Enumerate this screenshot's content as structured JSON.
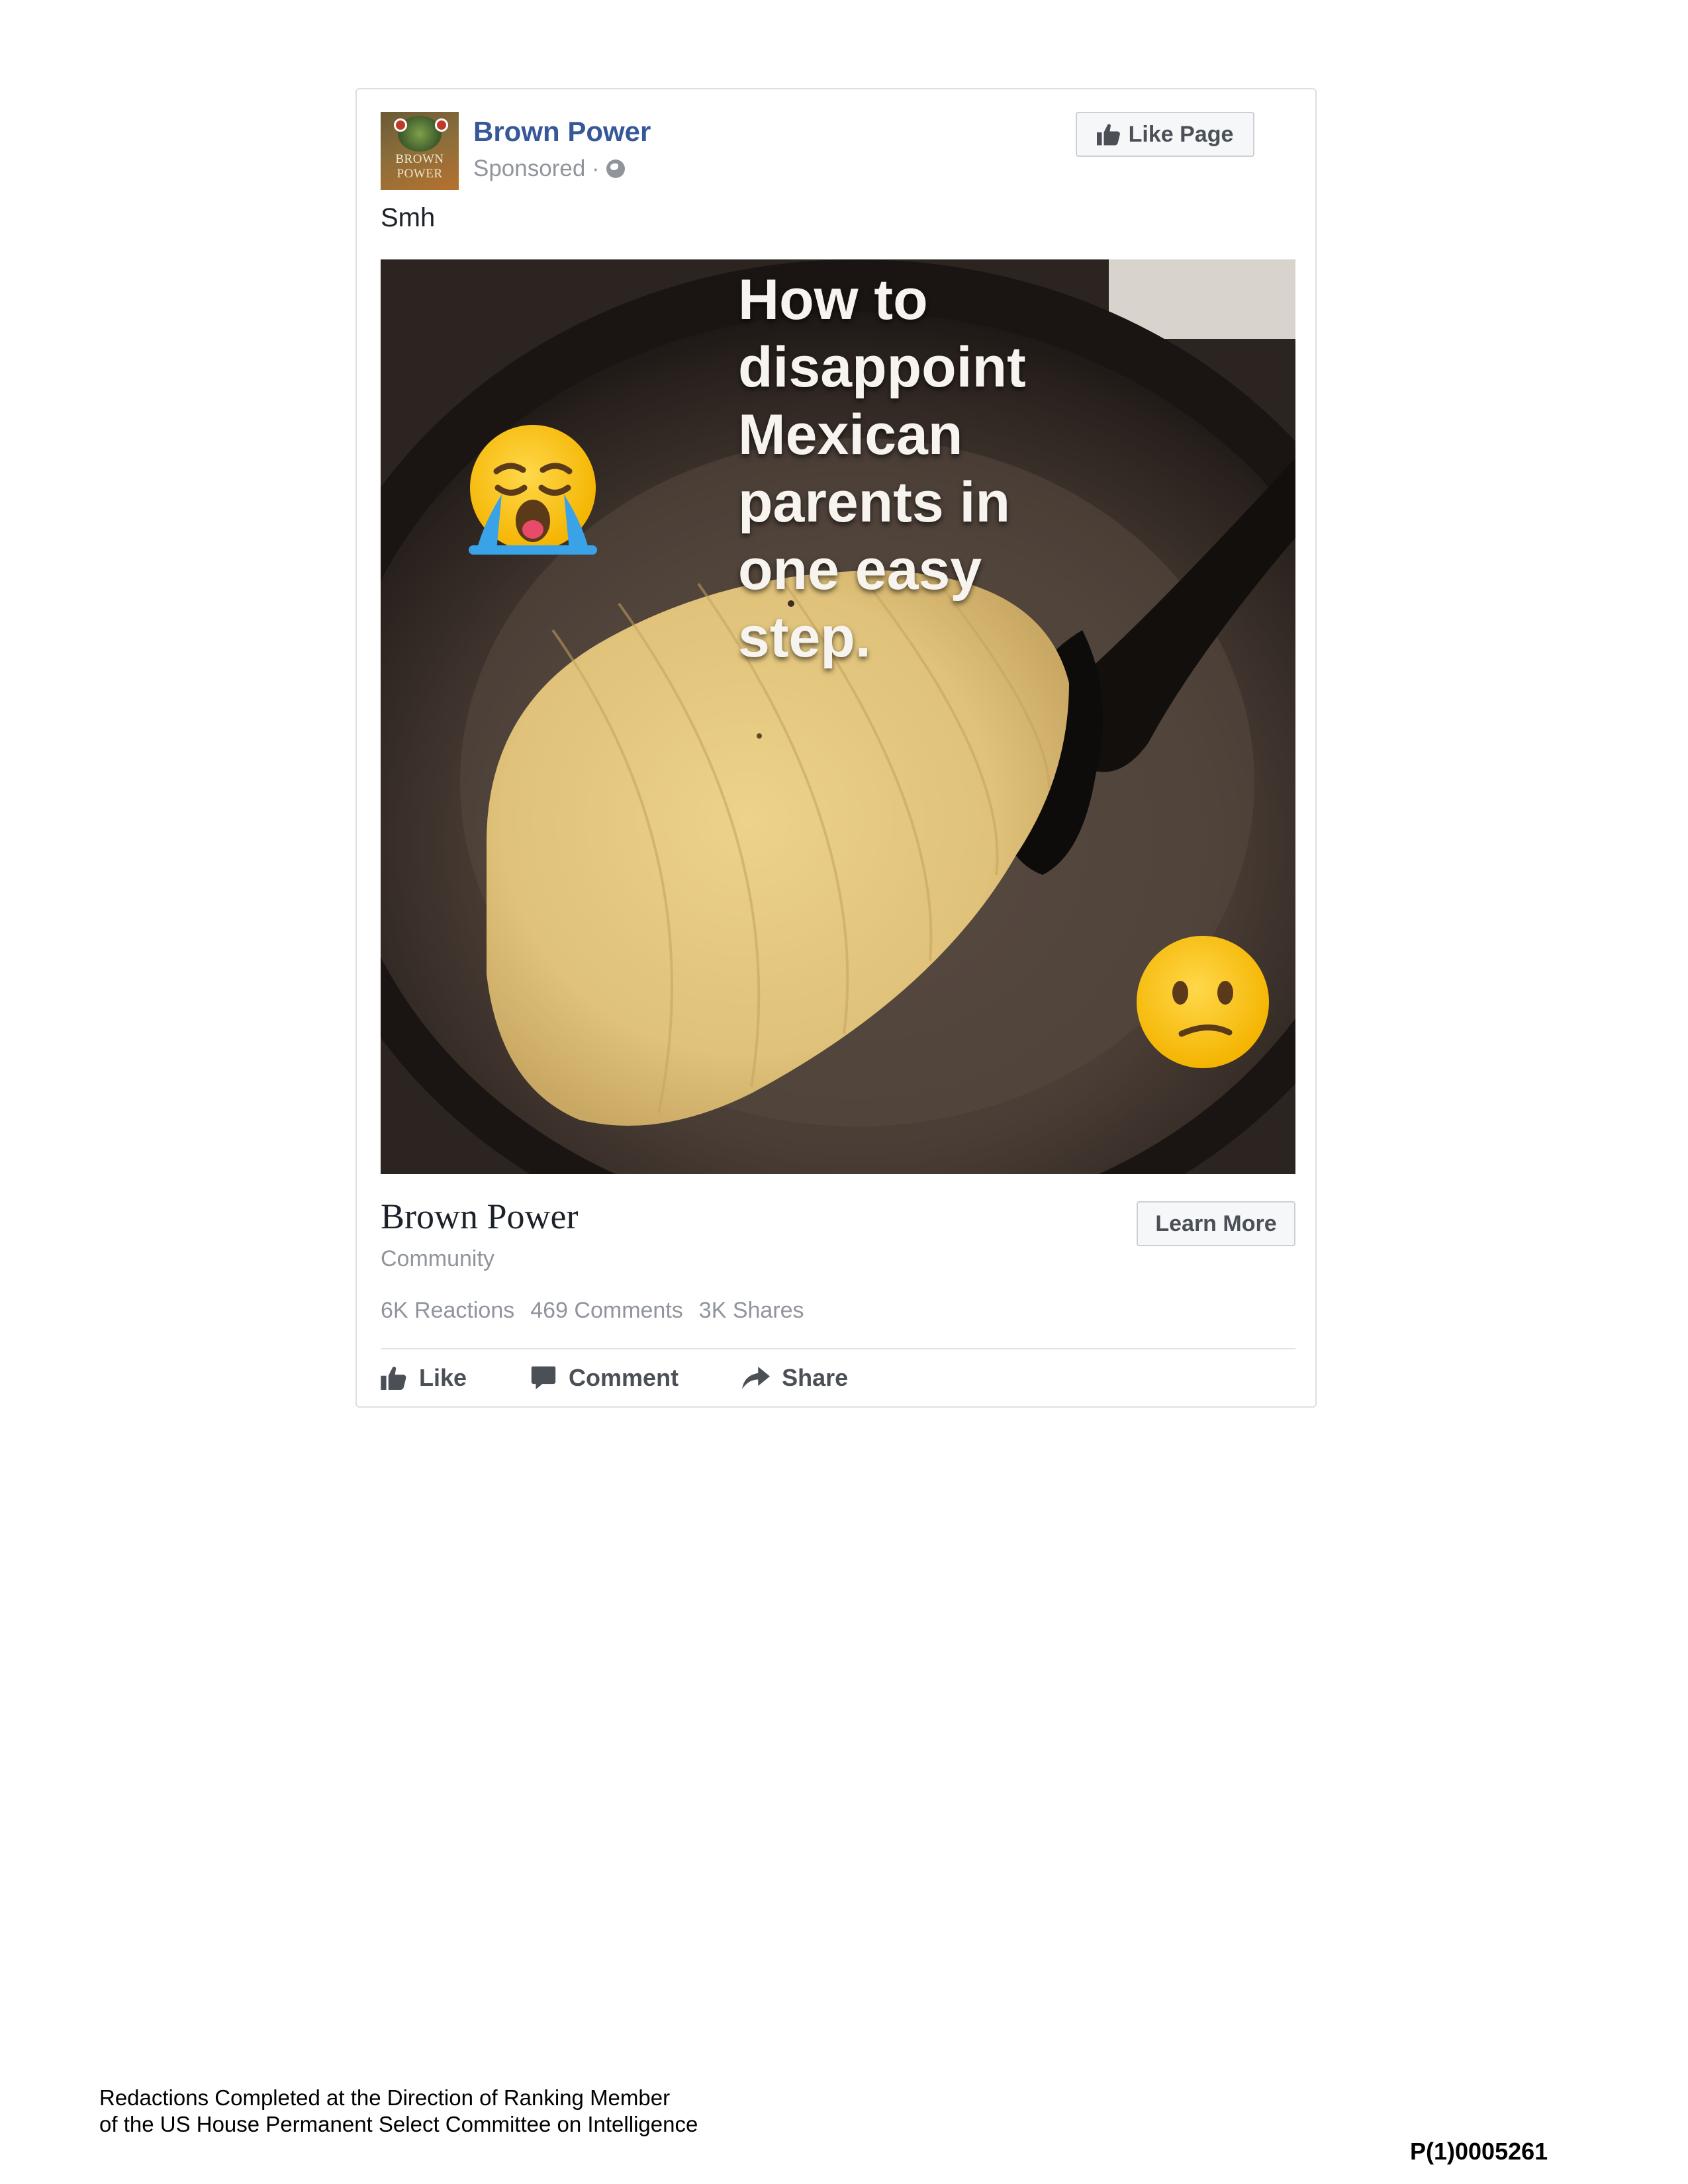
{
  "post": {
    "page_name": "Brown Power",
    "sponsored_label": "Sponsored ·",
    "like_page_label": "Like Page",
    "text": "Smh",
    "avatar_text": [
      "BROWN",
      "POWER"
    ],
    "image_caption_lines": [
      "How to",
      "disappoint",
      "Mexican",
      "parents in",
      "one easy",
      "step."
    ]
  },
  "link": {
    "title": "Brown Power",
    "subtitle": "Community",
    "cta_label": "Learn More"
  },
  "stats": {
    "reactions": "6K Reactions",
    "comments": "469 Comments",
    "shares": "3K Shares"
  },
  "actions": {
    "like": "Like",
    "comment": "Comment",
    "share": "Share"
  },
  "footer": {
    "redaction_line1": "Redactions Completed at the Direction of Ranking Member",
    "redaction_line2": "of the US House Permanent Select Committee on Intelligence",
    "bates_number": "P(1)0005261"
  },
  "colors": {
    "page_name": "#365899",
    "muted": "#90949c",
    "button_text": "#4b4f56"
  },
  "icons": [
    "globe-icon",
    "thumbs-up-icon",
    "comment-icon",
    "share-arrow-icon",
    "crying-face-emoji",
    "confused-face-emoji"
  ]
}
